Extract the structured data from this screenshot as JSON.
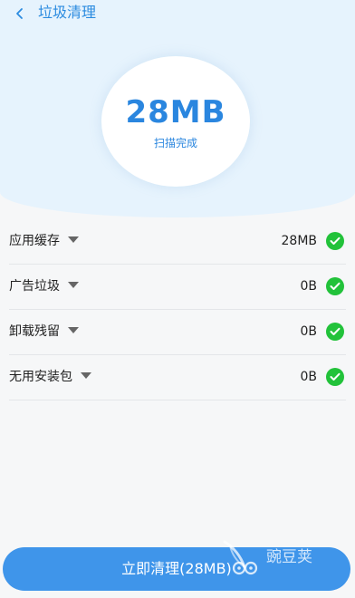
{
  "header": {
    "title": "垃圾清理",
    "back_icon": "chevron-left-icon"
  },
  "scan": {
    "size": "28MB",
    "status": "扫描完成"
  },
  "items": [
    {
      "label": "应用缓存",
      "size": "28MB",
      "status_icon": "check-circle-icon"
    },
    {
      "label": "广告垃圾",
      "size": "0B",
      "status_icon": "check-circle-icon"
    },
    {
      "label": "卸载残留",
      "size": "0B",
      "status_icon": "check-circle-icon"
    },
    {
      "label": "无用安装包",
      "size": "0B",
      "status_icon": "check-circle-icon"
    }
  ],
  "action": {
    "clean_label": "立即清理(28MB)"
  },
  "watermark": {
    "text": "豌豆荚"
  },
  "colors": {
    "accent": "#2a86df",
    "check": "#22c23a",
    "button": "#3f95ea",
    "top_background": "#e6f3fd"
  }
}
